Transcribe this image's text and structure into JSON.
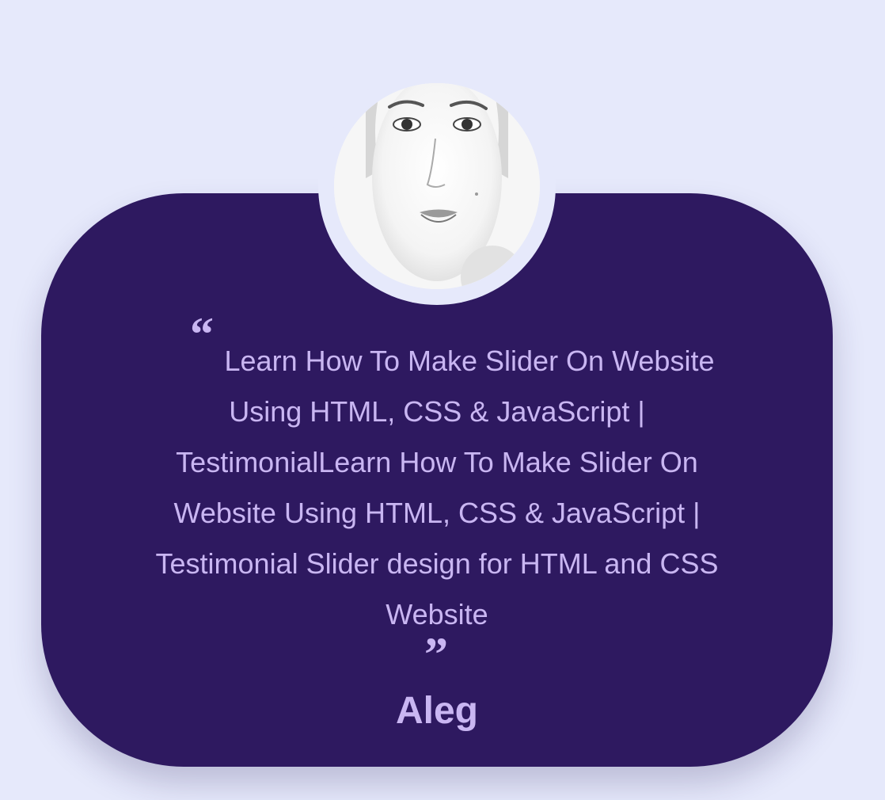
{
  "testimonial": {
    "avatar_icon": "portrait-photo",
    "quote_open_mark": "“",
    "quote_close_mark": "”",
    "text": "Learn How To Make Slider On Website Using HTML, CSS & JavaScript | TestimonialLearn How To Make Slider On Website Using HTML, CSS & JavaScript | Testimonial Slider design for HTML and CSS Website",
    "author": "Aleg"
  },
  "colors": {
    "background": "#e6e9fb",
    "card": "#2e1960",
    "text": "#c9b6f2"
  }
}
